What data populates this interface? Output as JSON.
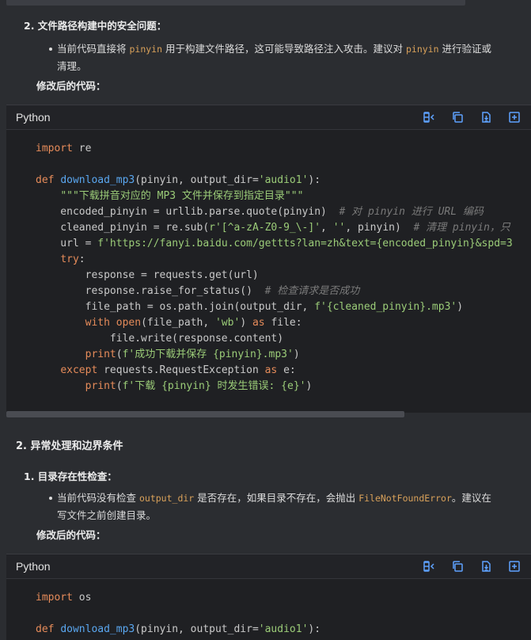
{
  "section1": {
    "item_label": "2. 文件路径构建中的安全问题：",
    "bullet_line1_a": "当前代码直接将 ",
    "bullet_code1": "pinyin",
    "bullet_line1_b": " 用于构建文件路径，这可能导致路径注入攻击。建议对 ",
    "bullet_code2": "pinyin",
    "bullet_line1_c": " 进行验证或",
    "bullet_line2": "清理。",
    "modified_label": "修改后的代码："
  },
  "code1": {
    "language": "Python",
    "lines": [
      "import re",
      "",
      "def download_mp3(pinyin, output_dir='audio1'):",
      "    \"\"\"下载拼音对应的 MP3 文件并保存到指定目录\"\"\"",
      "    encoded_pinyin = urllib.parse.quote(pinyin)  # 对 pinyin 进行 URL 编码",
      "    cleaned_pinyin = re.sub(r'[^a-zA-Z0-9_\\-]', '', pinyin)  # 清理 pinyin，只",
      "    url = f'https://fanyi.baidu.com/gettts?lan=zh&text={encoded_pinyin}&spd=3",
      "    try:",
      "        response = requests.get(url)",
      "        response.raise_for_status()  # 检查请求是否成功",
      "        file_path = os.path.join(output_dir, f'{cleaned_pinyin}.mp3')",
      "        with open(file_path, 'wb') as file:",
      "            file.write(response.content)",
      "        print(f'成功下载并保存 {pinyin}.mp3')",
      "    except requests.RequestException as e:",
      "        print(f'下载 {pinyin} 时发生错误: {e}')"
    ]
  },
  "section2": {
    "heading": "2. 异常处理和边界条件",
    "item_label": "1. 目录存在性检查：",
    "bullet_a": "当前代码没有检查 ",
    "bullet_code1": "output_dir",
    "bullet_b": " 是否存在，如果目录不存在，会抛出 ",
    "bullet_code2": "FileNotFoundError",
    "bullet_c": "。建议在",
    "bullet_line2": "写文件之前创建目录。",
    "modified_label": "修改后的代码："
  },
  "code2": {
    "language": "Python",
    "lines": [
      "import os",
      "",
      "def download_mp3(pinyin, output_dir='audio1'):"
    ]
  },
  "toolbar": {
    "icons": [
      "wrap-icon",
      "copy-icon",
      "download-icon",
      "insert-icon"
    ]
  },
  "colors": {
    "background": "#2b2d31",
    "code_background": "#1f2023",
    "keyword": "#e58b5a",
    "function": "#5aa7f0",
    "string": "#9bcc78",
    "comment": "#7a7a7a",
    "inline_code": "#d9a15a",
    "icon": "#5ea2ff"
  }
}
